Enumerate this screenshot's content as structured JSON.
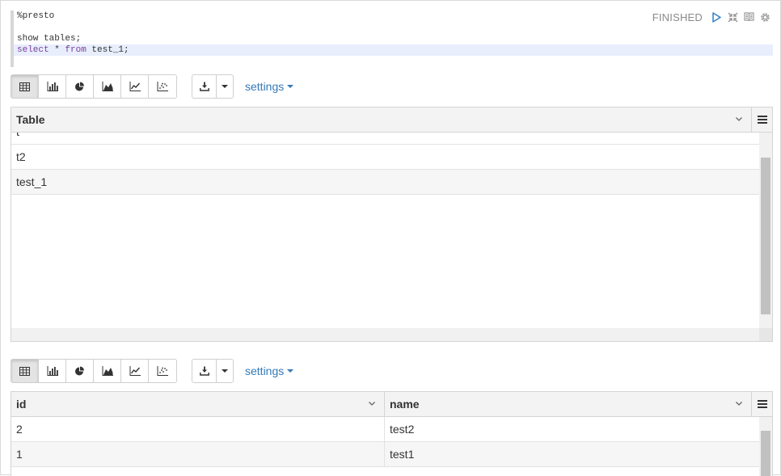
{
  "editor": {
    "lines": [
      "%presto",
      "",
      "show tables;"
    ],
    "last_line": {
      "kw1": "select",
      "star": " * ",
      "kw2": "from",
      "rest": " test_1;"
    }
  },
  "status": {
    "text": "FINISHED",
    "icons": [
      "run-icon",
      "collapse-icon",
      "book-icon",
      "gear-icon"
    ]
  },
  "toolbar": {
    "view_buttons": [
      "table-icon",
      "bar-chart-icon",
      "pie-chart-icon",
      "area-chart-icon",
      "line-chart-icon",
      "scatter-chart-icon"
    ],
    "active_view": "table-icon",
    "settings_label": "settings"
  },
  "result1": {
    "columns": [
      "Table"
    ],
    "rows": [
      "t",
      "t2",
      "test_1"
    ]
  },
  "result2": {
    "columns": [
      "id",
      "name"
    ],
    "rows": [
      [
        "2",
        "test2"
      ],
      [
        "1",
        "test1"
      ]
    ]
  }
}
